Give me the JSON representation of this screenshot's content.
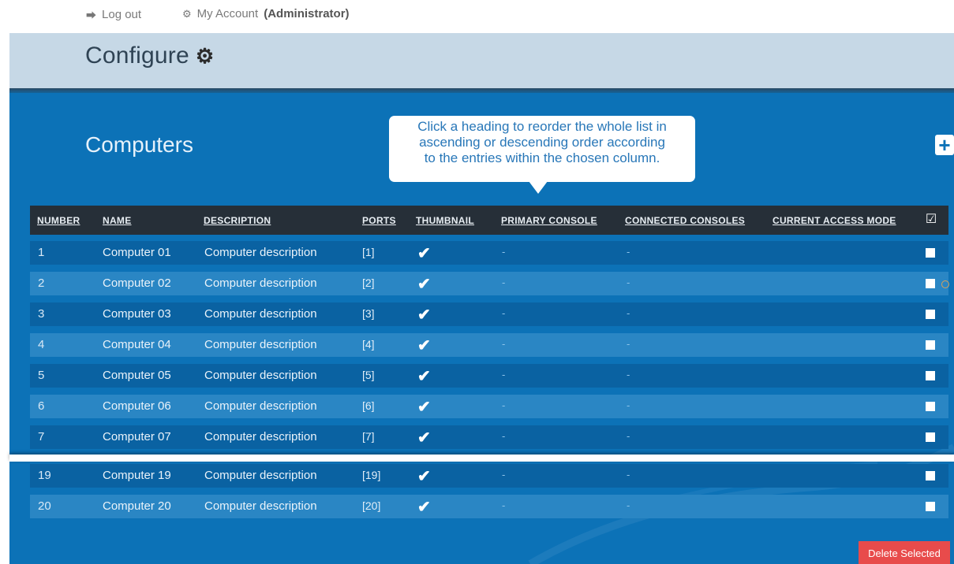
{
  "topbar": {
    "logout_label": "Log out",
    "account_label": "My Account",
    "account_role": "(Administrator)",
    "logout_icon": "sign-out-icon",
    "account_icon": "gears-icon"
  },
  "configure": {
    "title": "Configure",
    "icon": "gears-icon"
  },
  "section": {
    "title": "Computers",
    "add_icon": "plus-icon"
  },
  "tooltip": {
    "line1": "Click a heading to reorder the whole list in",
    "line2": "ascending or descending order according",
    "line3": "to the entries within the chosen column."
  },
  "table": {
    "headers": {
      "number": "NUMBER",
      "name": "NAME",
      "description": "DESCRIPTION",
      "ports": "PORTS",
      "thumbnail": "THUMBNAIL",
      "primary_console": "PRIMARY CONSOLE",
      "connected_consoles": "CONNECTED CONSOLES",
      "current_access_mode": "CURRENT ACCESS MODE"
    },
    "rows": [
      {
        "number": "1",
        "name": "Computer 01",
        "description": "Computer description",
        "ports": "[1]",
        "thumbnail": "✔",
        "primary": "-",
        "connected": "-"
      },
      {
        "number": "2",
        "name": "Computer 02",
        "description": "Computer description",
        "ports": "[2]",
        "thumbnail": "✔",
        "primary": "-",
        "connected": "-"
      },
      {
        "number": "3",
        "name": "Computer 03",
        "description": "Computer description",
        "ports": "[3]",
        "thumbnail": "✔",
        "primary": "-",
        "connected": "-"
      },
      {
        "number": "4",
        "name": "Computer 04",
        "description": "Computer description",
        "ports": "[4]",
        "thumbnail": "✔",
        "primary": "-",
        "connected": "-"
      },
      {
        "number": "5",
        "name": "Computer 05",
        "description": "Computer description",
        "ports": "[5]",
        "thumbnail": "✔",
        "primary": "-",
        "connected": "-"
      },
      {
        "number": "6",
        "name": "Computer 06",
        "description": "Computer description",
        "ports": "[6]",
        "thumbnail": "✔",
        "primary": "-",
        "connected": "-"
      },
      {
        "number": "7",
        "name": "Computer 07",
        "description": "Computer description",
        "ports": "[7]",
        "thumbnail": "✔",
        "primary": "-",
        "connected": "-"
      },
      {
        "number": "19",
        "name": "Computer 19",
        "description": "Computer description",
        "ports": "[19]",
        "thumbnail": "✔",
        "primary": "-",
        "connected": "-"
      },
      {
        "number": "20",
        "name": "Computer 20",
        "description": "Computer description",
        "ports": "[20]",
        "thumbnail": "✔",
        "primary": "-",
        "connected": "-"
      }
    ]
  },
  "footer": {
    "delete_label": "Delete Selected"
  },
  "colors": {
    "panel": "#0c72b7",
    "header_bar": "#262f38",
    "row_dark": "#0a62a2",
    "row_light": "#2a86c4",
    "configure_bar": "#c6d8e6",
    "delete_button": "#e84b4b"
  }
}
